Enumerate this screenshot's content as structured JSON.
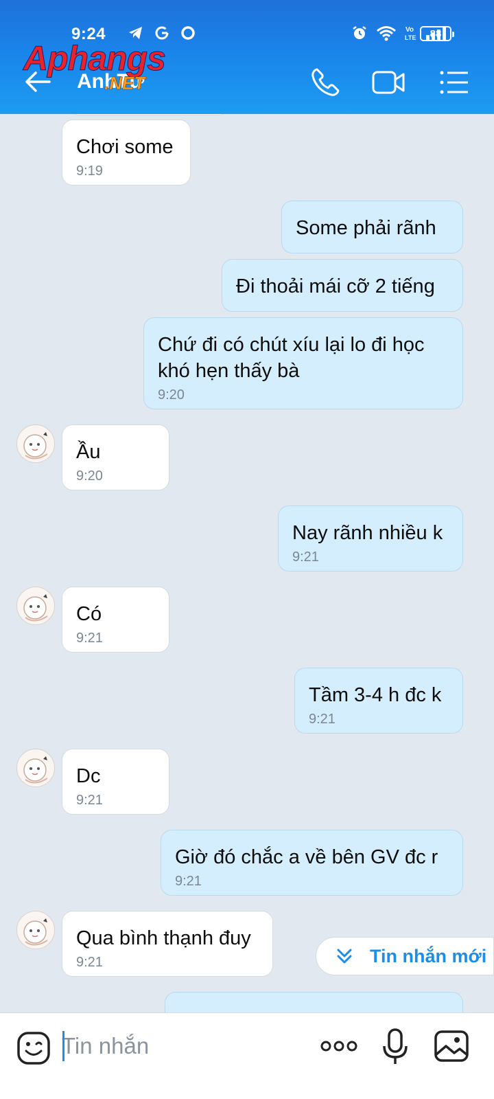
{
  "status_bar": {
    "time": "9:24",
    "battery": "88",
    "icons": [
      "telegram-icon",
      "google-icon",
      "circle-app-icon",
      "alarm-icon",
      "wifi-icon",
      "volte-icon",
      "signal-icon",
      "battery-icon"
    ]
  },
  "header": {
    "contact_name": "AnhTư",
    "watermark_main": "Aphangs",
    "watermark_sub": ".NET",
    "colors": {
      "gradient_top": "#1e71d9",
      "gradient_bottom": "#1c9cf2"
    }
  },
  "messages": [
    {
      "direction": "in",
      "text": "Chơi some",
      "time": "9:19",
      "avatar": false
    },
    {
      "direction": "out",
      "text": "Some phải rãnh",
      "time": ""
    },
    {
      "direction": "out",
      "text": "Đi thoải mái cỡ 2 tiếng",
      "time": ""
    },
    {
      "direction": "out",
      "text": "Chứ đi có chút xíu lại lo đi học khó hẹn thấy bà",
      "time": "9:20"
    },
    {
      "direction": "in",
      "text": "Ầu",
      "time": "9:20",
      "avatar": true
    },
    {
      "direction": "out",
      "text": "Nay rãnh nhiều k",
      "time": "9:21"
    },
    {
      "direction": "in",
      "text": "Có",
      "time": "9:21",
      "avatar": true
    },
    {
      "direction": "out",
      "text": "Tầm 3-4 h đc k",
      "time": "9:21"
    },
    {
      "direction": "in",
      "text": "Dc",
      "time": "9:21",
      "avatar": true
    },
    {
      "direction": "out",
      "text": "Giờ đó chắc a về bên GV đc r",
      "time": "9:21"
    },
    {
      "direction": "in",
      "text": "Qua bình thạnh đuy",
      "time": "9:21",
      "avatar": true
    }
  ],
  "new_message_pill": {
    "label": "Tin nhắn mới"
  },
  "composer": {
    "placeholder": "Tin nhắn",
    "value": ""
  },
  "colors": {
    "chat_bg": "#e2e8ef",
    "outgoing_bubble": "#d5eefd",
    "incoming_bubble": "#ffffff",
    "accent": "#1b8fe8"
  }
}
